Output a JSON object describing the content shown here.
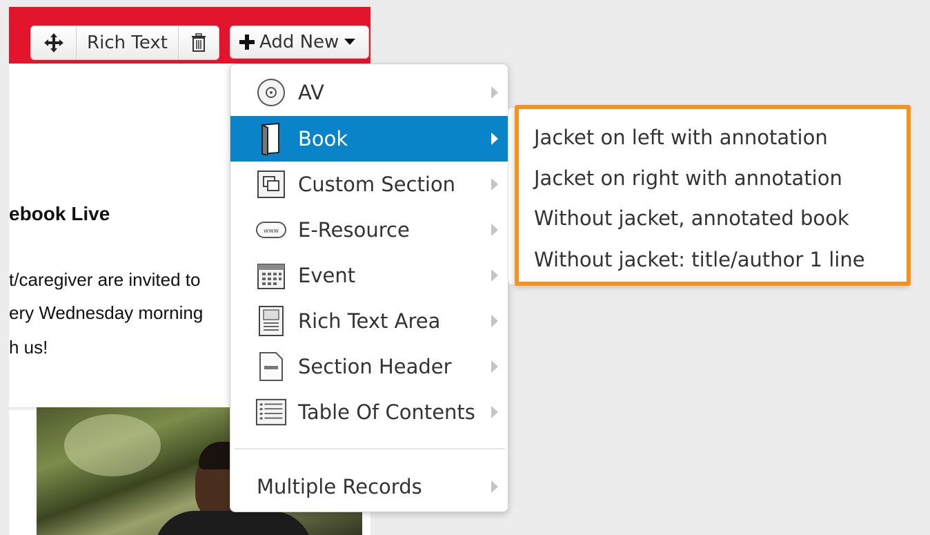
{
  "toolbar": {
    "move_icon": "move-arrows-icon",
    "rich_text_label": "Rich Text",
    "delete_icon": "trash-icon",
    "add_new_label": "Add New"
  },
  "article": {
    "heading": "ebook Live",
    "line1": "t/caregiver are invited to",
    "line2": "ery Wednesday morning",
    "line3": "h us!"
  },
  "menu": {
    "items": [
      {
        "label": "AV",
        "icon": "disc-icon"
      },
      {
        "label": "Book",
        "icon": "book-icon"
      },
      {
        "label": "Custom Section",
        "icon": "custom-section-icon"
      },
      {
        "label": "E-Resource",
        "icon": "www-icon"
      },
      {
        "label": "Event",
        "icon": "calendar-icon"
      },
      {
        "label": "Rich Text Area",
        "icon": "rich-text-area-icon"
      },
      {
        "label": "Section Header",
        "icon": "section-header-icon"
      },
      {
        "label": "Table Of Contents",
        "icon": "list-icon"
      }
    ],
    "multiple_records": "Multiple Records"
  },
  "submenu": {
    "items": [
      "Jacket on left with annotation",
      "Jacket on right with annotation",
      "Without jacket, annotated book",
      "Without jacket: title/author 1 line"
    ]
  },
  "colors": {
    "header_red": "#e3152c",
    "highlight_blue": "#0a84c8",
    "submenu_border": "#f39320"
  }
}
